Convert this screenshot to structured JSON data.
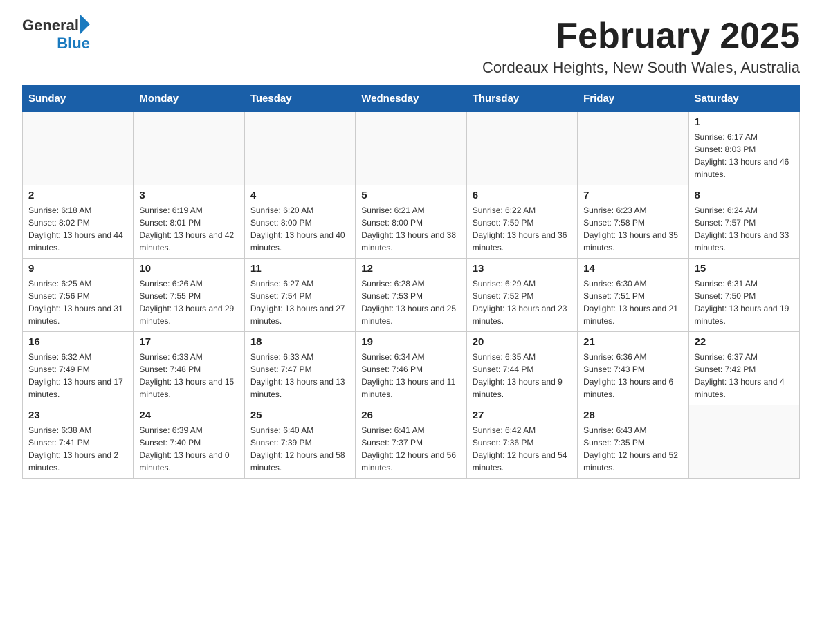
{
  "logo": {
    "general": "General",
    "blue": "Blue"
  },
  "title": "February 2025",
  "subtitle": "Cordeaux Heights, New South Wales, Australia",
  "days": [
    "Sunday",
    "Monday",
    "Tuesday",
    "Wednesday",
    "Thursday",
    "Friday",
    "Saturday"
  ],
  "weeks": [
    [
      {
        "date": "",
        "info": ""
      },
      {
        "date": "",
        "info": ""
      },
      {
        "date": "",
        "info": ""
      },
      {
        "date": "",
        "info": ""
      },
      {
        "date": "",
        "info": ""
      },
      {
        "date": "",
        "info": ""
      },
      {
        "date": "1",
        "info": "Sunrise: 6:17 AM\nSunset: 8:03 PM\nDaylight: 13 hours and 46 minutes."
      }
    ],
    [
      {
        "date": "2",
        "info": "Sunrise: 6:18 AM\nSunset: 8:02 PM\nDaylight: 13 hours and 44 minutes."
      },
      {
        "date": "3",
        "info": "Sunrise: 6:19 AM\nSunset: 8:01 PM\nDaylight: 13 hours and 42 minutes."
      },
      {
        "date": "4",
        "info": "Sunrise: 6:20 AM\nSunset: 8:00 PM\nDaylight: 13 hours and 40 minutes."
      },
      {
        "date": "5",
        "info": "Sunrise: 6:21 AM\nSunset: 8:00 PM\nDaylight: 13 hours and 38 minutes."
      },
      {
        "date": "6",
        "info": "Sunrise: 6:22 AM\nSunset: 7:59 PM\nDaylight: 13 hours and 36 minutes."
      },
      {
        "date": "7",
        "info": "Sunrise: 6:23 AM\nSunset: 7:58 PM\nDaylight: 13 hours and 35 minutes."
      },
      {
        "date": "8",
        "info": "Sunrise: 6:24 AM\nSunset: 7:57 PM\nDaylight: 13 hours and 33 minutes."
      }
    ],
    [
      {
        "date": "9",
        "info": "Sunrise: 6:25 AM\nSunset: 7:56 PM\nDaylight: 13 hours and 31 minutes."
      },
      {
        "date": "10",
        "info": "Sunrise: 6:26 AM\nSunset: 7:55 PM\nDaylight: 13 hours and 29 minutes."
      },
      {
        "date": "11",
        "info": "Sunrise: 6:27 AM\nSunset: 7:54 PM\nDaylight: 13 hours and 27 minutes."
      },
      {
        "date": "12",
        "info": "Sunrise: 6:28 AM\nSunset: 7:53 PM\nDaylight: 13 hours and 25 minutes."
      },
      {
        "date": "13",
        "info": "Sunrise: 6:29 AM\nSunset: 7:52 PM\nDaylight: 13 hours and 23 minutes."
      },
      {
        "date": "14",
        "info": "Sunrise: 6:30 AM\nSunset: 7:51 PM\nDaylight: 13 hours and 21 minutes."
      },
      {
        "date": "15",
        "info": "Sunrise: 6:31 AM\nSunset: 7:50 PM\nDaylight: 13 hours and 19 minutes."
      }
    ],
    [
      {
        "date": "16",
        "info": "Sunrise: 6:32 AM\nSunset: 7:49 PM\nDaylight: 13 hours and 17 minutes."
      },
      {
        "date": "17",
        "info": "Sunrise: 6:33 AM\nSunset: 7:48 PM\nDaylight: 13 hours and 15 minutes."
      },
      {
        "date": "18",
        "info": "Sunrise: 6:33 AM\nSunset: 7:47 PM\nDaylight: 13 hours and 13 minutes."
      },
      {
        "date": "19",
        "info": "Sunrise: 6:34 AM\nSunset: 7:46 PM\nDaylight: 13 hours and 11 minutes."
      },
      {
        "date": "20",
        "info": "Sunrise: 6:35 AM\nSunset: 7:44 PM\nDaylight: 13 hours and 9 minutes."
      },
      {
        "date": "21",
        "info": "Sunrise: 6:36 AM\nSunset: 7:43 PM\nDaylight: 13 hours and 6 minutes."
      },
      {
        "date": "22",
        "info": "Sunrise: 6:37 AM\nSunset: 7:42 PM\nDaylight: 13 hours and 4 minutes."
      }
    ],
    [
      {
        "date": "23",
        "info": "Sunrise: 6:38 AM\nSunset: 7:41 PM\nDaylight: 13 hours and 2 minutes."
      },
      {
        "date": "24",
        "info": "Sunrise: 6:39 AM\nSunset: 7:40 PM\nDaylight: 13 hours and 0 minutes."
      },
      {
        "date": "25",
        "info": "Sunrise: 6:40 AM\nSunset: 7:39 PM\nDaylight: 12 hours and 58 minutes."
      },
      {
        "date": "26",
        "info": "Sunrise: 6:41 AM\nSunset: 7:37 PM\nDaylight: 12 hours and 56 minutes."
      },
      {
        "date": "27",
        "info": "Sunrise: 6:42 AM\nSunset: 7:36 PM\nDaylight: 12 hours and 54 minutes."
      },
      {
        "date": "28",
        "info": "Sunrise: 6:43 AM\nSunset: 7:35 PM\nDaylight: 12 hours and 52 minutes."
      },
      {
        "date": "",
        "info": ""
      }
    ]
  ]
}
